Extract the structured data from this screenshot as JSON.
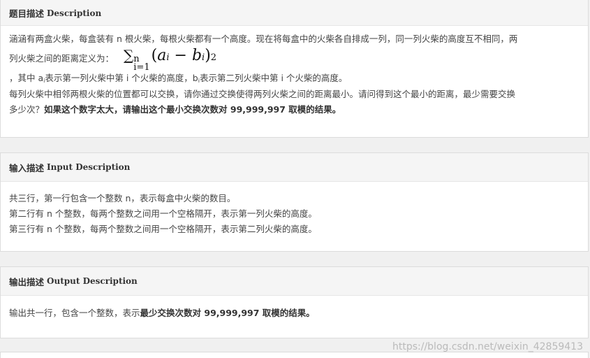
{
  "description": {
    "title_cn": "题目描述",
    "title_en": "Description",
    "line1": "涵涵有两盒火柴，每盒装有 n 根火柴，每根火柴都有一个高度。现在将每盒中的火柴各自排成一列，同一列火柴的高度互不相同，两",
    "line2": "列火柴之间的距离定义为：",
    "formula_sigma": "∑",
    "formula_upper": "n",
    "formula_lower": "i=1",
    "formula_open": "(",
    "formula_a": "a",
    "formula_a_sub": "i",
    "formula_minus": " − ",
    "formula_b": "b",
    "formula_b_sub": "i",
    "formula_close": ")",
    "formula_power": "2",
    "line3_a": "，其中 a",
    "line3_a_sub": "i",
    "line3_b": "表示第一列火柴中第 i 个火柴的高度，b",
    "line3_b_sub": "i",
    "line3_c": "表示第二列火柴中第 i 个火柴的高度。",
    "line4": "每列火柴中相邻两根火柴的位置都可以交换，请你通过交换使得两列火柴之间的距离最小。请问得到这个最小的距离，最少需要交换",
    "line5_normal": "多少次？",
    "line5_bold": "如果这个数字太大，请输出这个最小交换次数对 99,999,997 取模的结果。"
  },
  "input": {
    "title_cn": "输入描述",
    "title_en": "Input Description",
    "line1": "共三行，第一行包含一个整数 n，表示每盒中火柴的数目。",
    "line2": "第二行有 n 个整数，每两个整数之间用一个空格隔开，表示第一列火柴的高度。",
    "line3": "第三行有 n 个整数，每两个整数之间用一个空格隔开，表示第二列火柴的高度。"
  },
  "output": {
    "title_cn": "输出描述",
    "title_en": "Output Description",
    "line_normal": "输出共一行，包含一个整数，表示",
    "line_bold": "最少交换次数对 99,999,997 取模的结果。"
  },
  "watermark": "https://blog.csdn.net/weixin_42859413"
}
